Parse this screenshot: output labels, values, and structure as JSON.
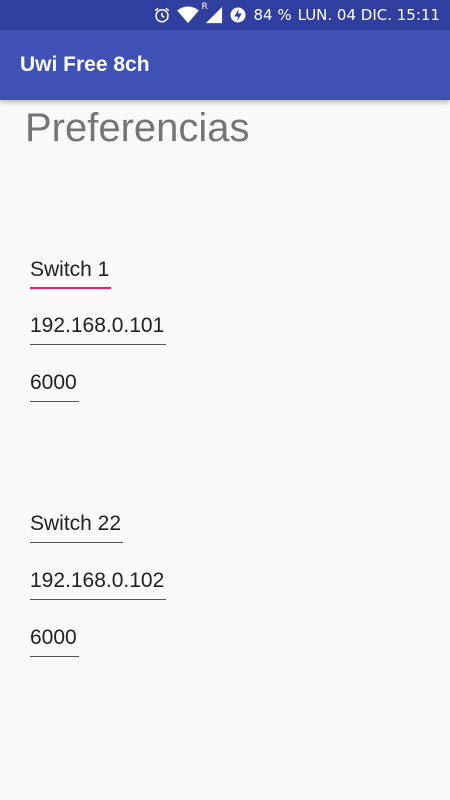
{
  "status_bar": {
    "battery": "84 %",
    "date_time": "LUN. 04 DIC. 15:11",
    "roaming_indicator": "R",
    "icons": [
      "alarm-icon",
      "wifi-icon",
      "signal-icon",
      "data-saver-icon",
      "battery-icon"
    ]
  },
  "app_bar": {
    "title": "Uwi Free 8ch"
  },
  "page": {
    "heading": "Preferencias"
  },
  "groups": [
    {
      "name": "Switch 1",
      "ip": "192.168.0.101",
      "port": "6000"
    },
    {
      "name": "Switch 22",
      "ip": "192.168.0.102",
      "port": "6000"
    }
  ],
  "colors": {
    "status_bar": "#303f9f",
    "app_bar": "#3f51b5",
    "focus_accent": "#e91e63",
    "background": "#fafafa"
  }
}
